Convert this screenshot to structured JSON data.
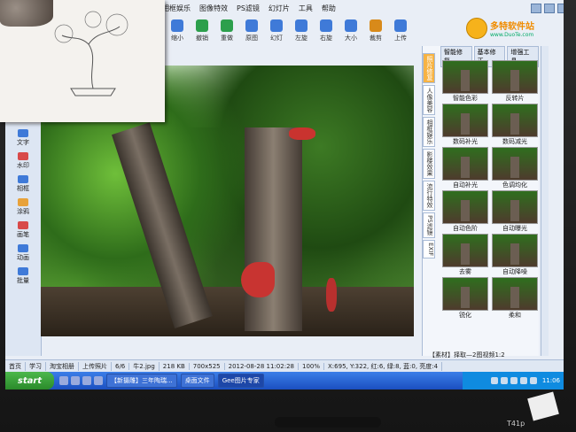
{
  "menu": {
    "items": [
      "相框娱乐",
      "图像特效",
      "PS滤镜",
      "幻灯片",
      "工具",
      "帮助"
    ]
  },
  "logo": {
    "brand": "多特软件站",
    "site": "www.DuoTe.com"
  },
  "toolbar": {
    "buttons": [
      {
        "label": "缩小",
        "icon": "zoom-out-icon",
        "color": "#3f7ad8"
      },
      {
        "label": "撤销",
        "icon": "undo-icon",
        "color": "#2c9f4c"
      },
      {
        "label": "重做",
        "icon": "redo-icon",
        "color": "#2c9f4c"
      },
      {
        "label": "原图",
        "icon": "original-icon",
        "color": "#3f7ad8"
      },
      {
        "label": "幻灯",
        "icon": "slideshow-icon",
        "color": "#3f7ad8"
      },
      {
        "label": "左旋",
        "icon": "rotate-left-icon",
        "color": "#3f7ad8"
      },
      {
        "label": "右旋",
        "icon": "rotate-right-icon",
        "color": "#3f7ad8"
      },
      {
        "label": "大小",
        "icon": "resize-icon",
        "color": "#3f7ad8"
      },
      {
        "label": "裁剪",
        "icon": "crop-icon",
        "color": "#d88a1a"
      },
      {
        "label": "上传",
        "icon": "upload-icon",
        "color": "#3f7ad8"
      }
    ]
  },
  "leftpanel": {
    "items": [
      {
        "label": "文字",
        "icon": "text-icon",
        "color": "#3f7ad8"
      },
      {
        "label": "水印",
        "icon": "watermark-icon",
        "color": "#d84a4a"
      },
      {
        "label": "相框",
        "icon": "frame-icon",
        "color": "#3f7ad8"
      },
      {
        "label": "涂鸦",
        "icon": "doodle-icon",
        "color": "#e8a23a"
      },
      {
        "label": "画笔",
        "icon": "brush-icon",
        "color": "#d84a4a"
      },
      {
        "label": "动画",
        "icon": "animation-icon",
        "color": "#3f7ad8"
      },
      {
        "label": "批量",
        "icon": "batch-icon",
        "color": "#3f7ad8"
      }
    ]
  },
  "rightpanel": {
    "tabs": [
      "智能修复",
      "基本修正",
      "增强工具"
    ],
    "vtabs": [
      "照片修复",
      "人像美容",
      "相框娱乐",
      "影楼效果",
      "流行特效",
      "PS滤镜",
      "EXIF"
    ],
    "thumbs": [
      "智能色彩",
      "反转片",
      "数码补光",
      "数码减光",
      "自动补光",
      "色调均化",
      "自动色阶",
      "自动曝光",
      "去雾",
      "自动降噪",
      "锐化",
      "柔和"
    ],
    "caption": "【素材】择取—2图视频1:2"
  },
  "status": {
    "items": [
      "首页",
      "学习",
      "淘宝相册",
      "上传照片",
      "6/6",
      "牛2.jpg",
      "218 KB",
      "700x525",
      "2012-08-28 11:02:28",
      "100%",
      "X:695, Y:322, 红:6, 绿:8, 蓝:0, 亮度:4"
    ]
  },
  "taskbar": {
    "start": "start",
    "tasks": [
      {
        "label": "【新摄雕】三年陶瑞...",
        "active": false
      },
      {
        "label": "桌面文件",
        "active": false
      },
      {
        "label": "Gee图片专家",
        "active": true
      }
    ],
    "clock": "11:06"
  },
  "bezel": {
    "model": "T41p"
  }
}
